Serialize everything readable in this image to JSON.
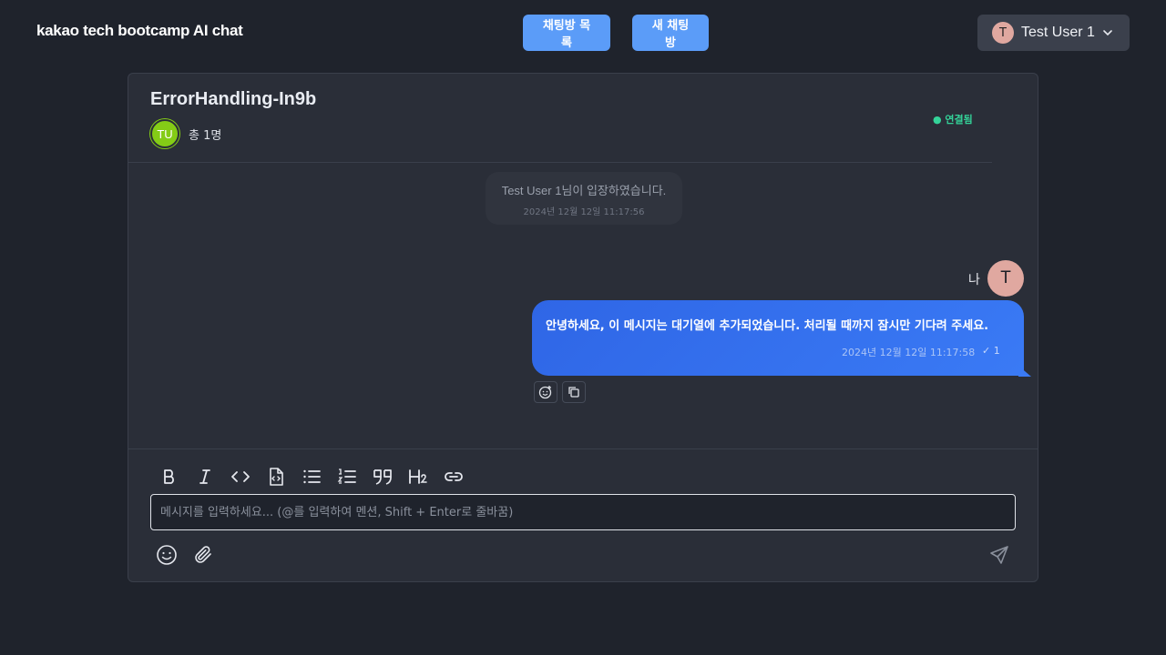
{
  "app": {
    "logo_text": "kakao tech bootcamp AI chat"
  },
  "nav": {
    "room_list_label": "채팅방 목록",
    "new_room_label": "새 채팅방"
  },
  "user_menu": {
    "avatar_initial": "T",
    "name": "Test User 1"
  },
  "room": {
    "title": "ErrorHandling-In9b",
    "member_avatar_initials": "TU",
    "member_count_text": "총 1명",
    "connection_status": "● 연결됨"
  },
  "messages": {
    "system": {
      "text": "Test User 1님이 입장하였습니다.",
      "time": "2024년 12월 12일 11:17:56"
    },
    "own": {
      "sender_label": "나",
      "avatar_initial": "T",
      "text": "안녕하세요, 이 메시지는 대기열에 추가되었습니다. 처리될 때까지 잠시만 기다려 주세요.",
      "time": "2024년 12월 12일 11:17:58",
      "read_count": "✓ 1"
    }
  },
  "composer": {
    "placeholder": "메시지를 입력하세요... (@를 입력하여 멘션, Shift + Enter로 줄바꿈)",
    "toolbar_icons": [
      "bold-icon",
      "italic-icon",
      "code-icon",
      "code-block-icon",
      "bullet-list-icon",
      "ordered-list-icon",
      "quote-icon",
      "heading-icon",
      "link-icon"
    ],
    "bottom_icons": [
      "emoji-icon",
      "paperclip-icon",
      "send-icon"
    ]
  },
  "colors": {
    "background": "#1f232c",
    "panel": "#2a2e38",
    "accent_button": "#5b9cf8",
    "own_bubble": "#3a7af5",
    "connected": "#34d399",
    "member_avatar": "#84cc16"
  }
}
